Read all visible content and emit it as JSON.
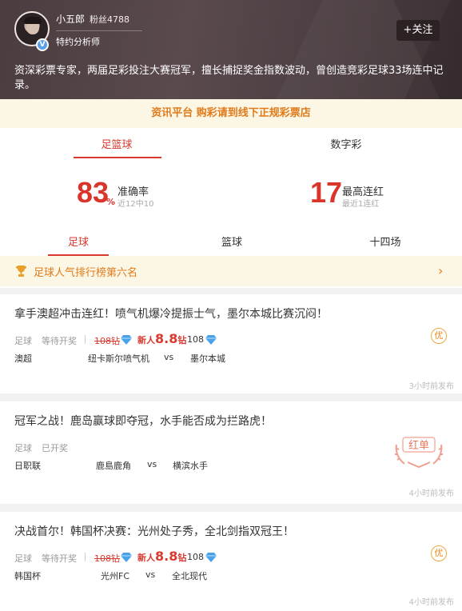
{
  "header": {
    "username": "小五郎",
    "fans": "粉丝4788",
    "role": "特约分析师",
    "follow_label": "+关注",
    "bio": "资深彩票专家，两届足彩投注大赛冠军，擅长捕捉奖金指数波动，曾创造竞彩足球33场连中记录。"
  },
  "notice": "资讯平台 购彩请到线下正规彩票店",
  "tabs": [
    "足篮球",
    "数字彩"
  ],
  "stats": {
    "accuracy": {
      "value": "83",
      "unit": "%",
      "label": "准确率",
      "sub": "近12中10"
    },
    "streak": {
      "value": "17",
      "label": "最高连红",
      "sub": "最近1连红"
    }
  },
  "subtabs": [
    "足球",
    "篮球",
    "十四场"
  ],
  "rank": {
    "label": "足球人气排行榜第六名",
    "arrow": "›"
  },
  "articles": [
    {
      "title": "拿手澳超冲击连红！喷气机爆冷提振士气，墨尔本城比赛沉闷！",
      "sport": "足球",
      "status": "等待开奖",
      "price_old": "108钻",
      "newuser_label": "新人",
      "newuser_price": "8.8",
      "newuser_unit": "钻",
      "price_new": "108",
      "league": "澳超",
      "home": "纽卡斯尔喷气机",
      "vs": "vs",
      "away": "墨尔本城",
      "badge": "优",
      "time": "3小时前发布"
    },
    {
      "title": "冠军之战！鹿岛赢球即夺冠，水手能否成为拦路虎！",
      "sport": "足球",
      "status": "已开奖",
      "league": "日职联",
      "home": "鹿島鹿角",
      "vs": "vs",
      "away": "横滨水手",
      "badge": "红单",
      "time": "4小时前发布"
    },
    {
      "title": "决战首尔！韩国杯决赛：光州处子秀，全北剑指双冠王！",
      "sport": "足球",
      "status": "等待开奖",
      "price_old": "108钻",
      "newuser_label": "新人",
      "newuser_price": "8.8",
      "newuser_unit": "钻",
      "price_new": "108",
      "league": "韩国杯",
      "home": "光州FC",
      "vs": "vs",
      "away": "全北现代",
      "badge": "优",
      "time": "4小时前发布"
    }
  ],
  "colors": {
    "accent": "#d83a2f",
    "gold": "#e07b1a",
    "diamond": "#4aa3ea"
  }
}
